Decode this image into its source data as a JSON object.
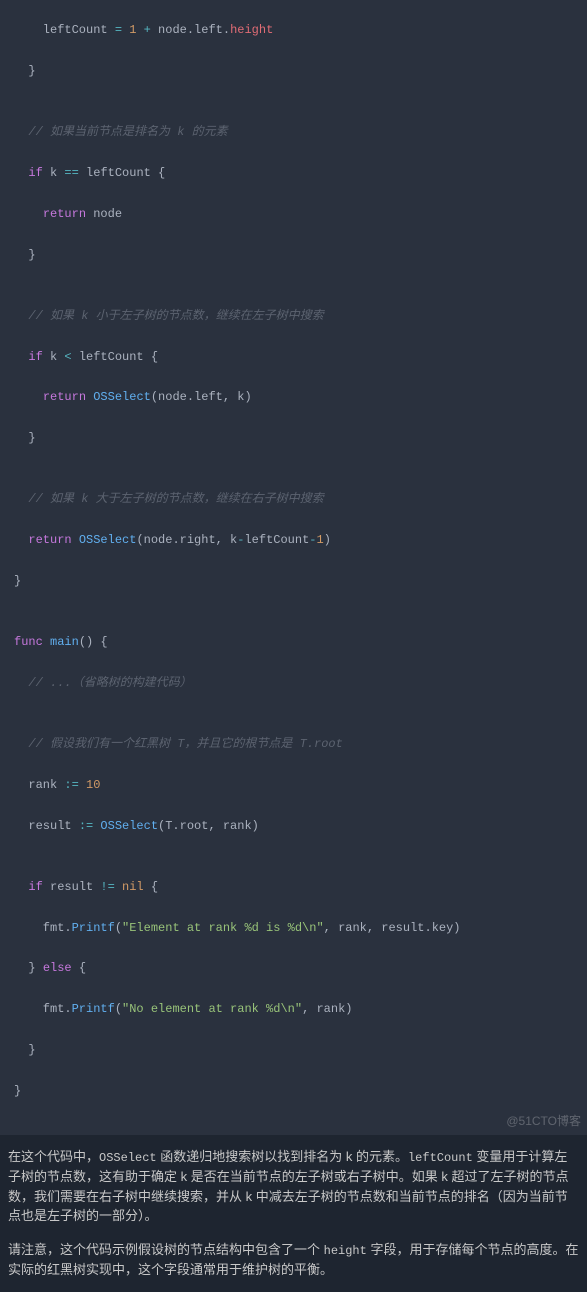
{
  "code": {
    "l1_a": "    leftCount ",
    "l1_b": "=",
    "l1_c": " ",
    "l1_d": "1",
    "l1_e": " ",
    "l1_f": "+",
    "l1_g": " node.left.",
    "l1_h": "height",
    "l2": "  }",
    "c1": "  // 如果当前节点是排名为 k 的元素",
    "l3_a": "  ",
    "l3_b": "if",
    "l3_c": " k ",
    "l3_d": "==",
    "l3_e": " leftCount {",
    "l4_a": "    ",
    "l4_b": "return",
    "l4_c": " node",
    "l5": "  }",
    "c2": "  // 如果 k 小于左子树的节点数，继续在左子树中搜索",
    "l6_a": "  ",
    "l6_b": "if",
    "l6_c": " k ",
    "l6_d": "<",
    "l6_e": " leftCount {",
    "l7_a": "    ",
    "l7_b": "return",
    "l7_c": " ",
    "l7_d": "OSSelect",
    "l7_e": "(node.left, k)",
    "l8": "  }",
    "c3": "  // 如果 k 大于左子树的节点数，继续在右子树中搜索",
    "l9_a": "  ",
    "l9_b": "return",
    "l9_c": " ",
    "l9_d": "OSSelect",
    "l9_e": "(node.right, k",
    "l9_f": "-",
    "l9_g": "leftCount",
    "l9_h": "-",
    "l9_i": "1",
    "l9_j": ")",
    "l10": "}",
    "l11_a": "func",
    "l11_b": " ",
    "l11_c": "main",
    "l11_d": "() {",
    "c4": "  // ...（省略树的构建代码）",
    "c5": "  // 假设我们有一个红黑树 T，并且它的根节点是 T.root",
    "l12_a": "  rank ",
    "l12_b": ":=",
    "l12_c": " ",
    "l12_d": "10",
    "l13_a": "  result ",
    "l13_b": ":=",
    "l13_c": " ",
    "l13_d": "OSSelect",
    "l13_e": "(T.root, rank)",
    "l14_a": "  ",
    "l14_b": "if",
    "l14_c": " result ",
    "l14_d": "!=",
    "l14_e": " ",
    "l14_f": "nil",
    "l14_g": " {",
    "l15_a": "    fmt.",
    "l15_b": "Printf",
    "l15_c": "(",
    "l15_d": "\"Element at rank %d is %d\\n\"",
    "l15_e": ", rank, result.key)",
    "l16_a": "  } ",
    "l16_b": "else",
    "l16_c": " {",
    "l17_a": "    fmt.",
    "l17_b": "Printf",
    "l17_c": "(",
    "l17_d": "\"No element at rank %d\\n\"",
    "l17_e": ", rank)",
    "l18": "  }",
    "l19": "}"
  },
  "watermark": "@51CTO博客",
  "text": {
    "p1_a": "在这个代码中，",
    "p1_b": "OSSelect",
    "p1_c": " 函数递归地搜索树以找到排名为 k 的元素。",
    "p1_d": "leftCount",
    "p1_e": " 变量用于计算左子树的节点数，这有助于确定 k 是否在当前节点的左子树或右子树中。如果 k 超过了左子树的节点数，我们需要在右子树中继续搜索，并从 k 中减去左子树的节点数和当前节点的排名（因为当前节点也是左子树的一部分）。",
    "p2_a": "请注意，这个代码示例假设树的节点结构中包含了一个 ",
    "p2_b": "height",
    "p2_c": " 字段，用于存储每个节点的高度。在实际的红黑树实现中，这个字段通常用于维护树的平衡。"
  }
}
